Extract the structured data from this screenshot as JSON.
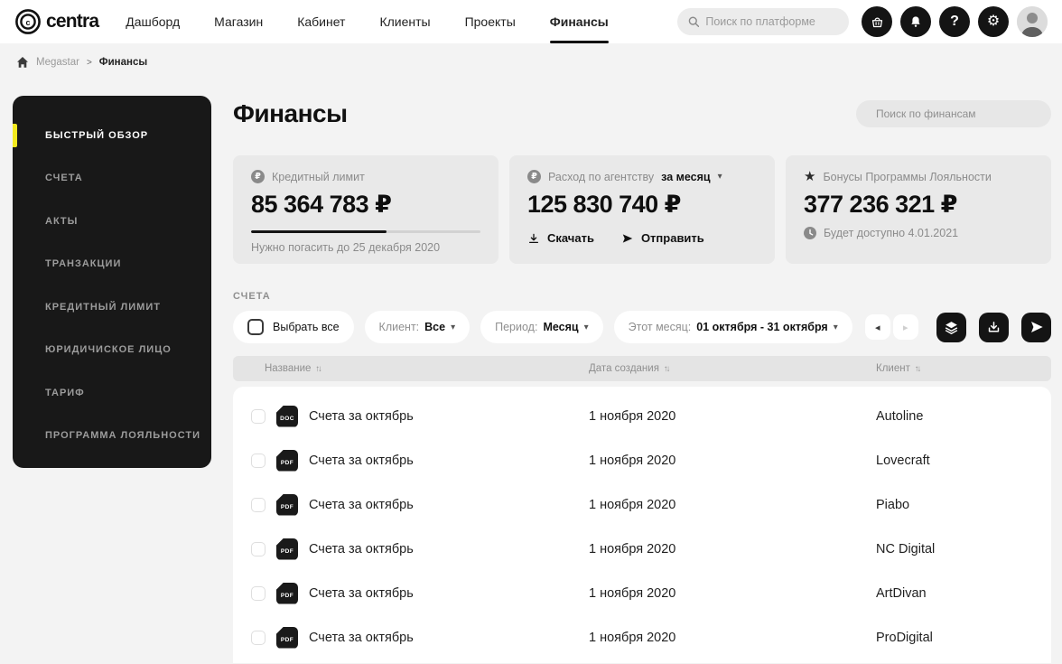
{
  "colors": {
    "accent_yellow": "#f2e91e",
    "sidebar_bg": "#181818",
    "card_bg": "#e9e9e9",
    "button_black": "#141414"
  },
  "icons": {
    "sort": "↑↓",
    "caret_down": "▾",
    "prev": "◂",
    "next": "▸",
    "star": "★",
    "gear": "⚙",
    "help": "?",
    "ruble": "₽"
  },
  "nav": {
    "logo_text": "centra",
    "items": [
      {
        "label": "Дашборд",
        "active": false
      },
      {
        "label": "Магазин",
        "active": false
      },
      {
        "label": "Кабинет",
        "active": false
      },
      {
        "label": "Клиенты",
        "active": false
      },
      {
        "label": "Проекты",
        "active": false
      },
      {
        "label": "Финансы",
        "active": true
      }
    ],
    "search_placeholder": "Поиск по платформе"
  },
  "breadcrumb": {
    "root": "Megastar",
    "separator": ">",
    "current": "Финансы"
  },
  "sidebar": {
    "items": [
      {
        "label": "БЫСТРЫЙ ОБЗОР",
        "active": true
      },
      {
        "label": "СЧЕТА",
        "active": false
      },
      {
        "label": "АКТЫ",
        "active": false
      },
      {
        "label": "ТРАНЗАКЦИИ",
        "active": false
      },
      {
        "label": "КРЕДИТНЫЙ ЛИМИТ",
        "active": false
      },
      {
        "label": "ЮРИДИЧИСКОЕ ЛИЦО",
        "active": false
      },
      {
        "label": "ТАРИФ",
        "active": false
      },
      {
        "label": "ПРОГРАММА ЛОЯЛЬНОСТИ",
        "active": false
      }
    ]
  },
  "page": {
    "title": "Финансы",
    "search_placeholder": "Поиск по финансам"
  },
  "cards": {
    "credit": {
      "label": "Кредитный лимит",
      "value": "85 364 783 ₽",
      "progress_percent": 59,
      "footer": "Нужно погасить до 25 декабря 2020"
    },
    "spend": {
      "label": "Расход по агентству",
      "period_value": "за месяц",
      "value": "125 830 740 ₽",
      "download_label": "Скачать",
      "send_label": "Отправить"
    },
    "bonus": {
      "label": "Бонусы Программы Лояльности",
      "value": "377 236 321 ₽",
      "footer": "Будет доступно 4.01.2021"
    }
  },
  "invoices": {
    "section_label": "СЧЕТА",
    "filters": {
      "select_all_label": "Выбрать все",
      "client_label": "Клиент:",
      "client_value": "Все",
      "period_label": "Период:",
      "period_value": "Месяц",
      "month_label": "Этот месяц:",
      "month_value": "01 октября - 31 октября"
    },
    "pagination": {
      "prev_enabled": true,
      "next_enabled": false
    },
    "table": {
      "columns": [
        "Название",
        "Дата создания",
        "Клиент"
      ],
      "rows": [
        {
          "type": "DOC",
          "name": "Счета за октябрь",
          "date": "1 ноября 2020",
          "client": "Autoline"
        },
        {
          "type": "PDF",
          "name": "Счета за октябрь",
          "date": "1 ноября 2020",
          "client": "Lovecraft"
        },
        {
          "type": "PDF",
          "name": "Счета за октябрь",
          "date": "1 ноября 2020",
          "client": "Piabo"
        },
        {
          "type": "PDF",
          "name": "Счета за октябрь",
          "date": "1 ноября 2020",
          "client": "NC Digital"
        },
        {
          "type": "PDF",
          "name": "Счета за октябрь",
          "date": "1 ноября 2020",
          "client": "ArtDivan"
        },
        {
          "type": "PDF",
          "name": "Счета за октябрь",
          "date": "1 ноября 2020",
          "client": "ProDigital"
        }
      ]
    }
  }
}
